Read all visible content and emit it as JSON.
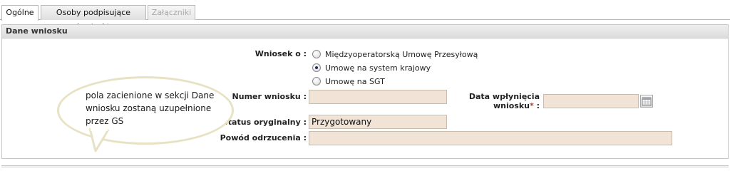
{
  "tabs": [
    {
      "label": "Ogólne",
      "state": "active"
    },
    {
      "label": "Osoby podpisujące kontrakt",
      "state": "normal"
    },
    {
      "label": "Załączniki",
      "state": "disabled"
    }
  ],
  "panel": {
    "title": "Dane wniosku"
  },
  "form": {
    "wniosek_label": "Wniosek o :",
    "options": [
      {
        "label": "Międzyoperatorską Umowę Przesyłową",
        "checked": false
      },
      {
        "label": "Umowę na system krajowy",
        "checked": true
      },
      {
        "label": "Umowę na SGT",
        "checked": false
      }
    ],
    "numer_label": "Numer wniosku :",
    "numer_value": "",
    "data_label_line1": "Data wpłynięcia",
    "data_label_line2": "wniosku",
    "data_label_suffix": " :",
    "required_mark": "*",
    "data_value": "",
    "status_label": "Status oryginalny :",
    "status_value": "Przygotowany",
    "powod_label": "Powód odrzucenia :",
    "powod_value": ""
  },
  "callout": {
    "text": "pola zacienione w sekcji Dane wniosku zostaną uzupełnione przez GS"
  },
  "icons": {
    "calendar": "calendar-icon"
  },
  "colors": {
    "field_bg": "#f1e4d6",
    "callout_border": "#e8e2c4",
    "required": "#c0392b"
  }
}
